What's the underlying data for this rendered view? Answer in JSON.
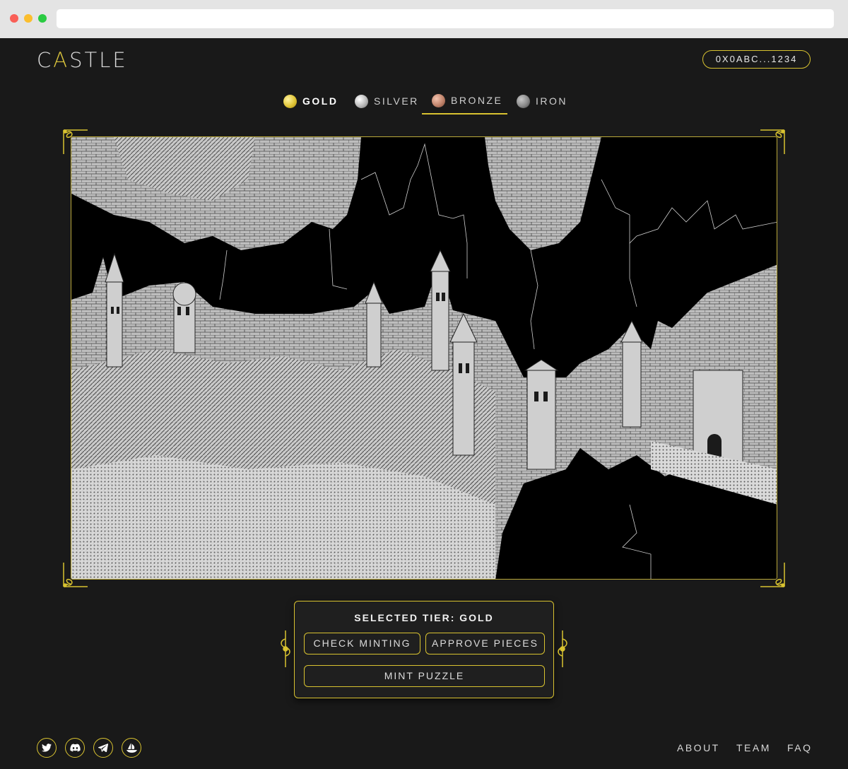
{
  "header": {
    "logo_prefix": "C",
    "logo_accent": "A",
    "logo_suffix": "STLE",
    "wallet_address": "0X0ABC...1234"
  },
  "tiers": [
    {
      "label": "GOLD",
      "color": "#e0c537"
    },
    {
      "label": "SILVER",
      "color": "#b9b9b9"
    },
    {
      "label": "BRONZE",
      "color": "#c0836b"
    },
    {
      "label": "IRON",
      "color": "#8a8a8a"
    }
  ],
  "panel": {
    "selected_tier_text": "SELECTED TIER: GOLD",
    "check_minting_label": "CHECK MINTING",
    "approve_pieces_label": "APPROVE PIECES",
    "mint_puzzle_label": "MINT PUZZLE"
  },
  "footer": {
    "social_icons": [
      "twitter-icon",
      "discord-icon",
      "telegram-icon",
      "opensea-icon"
    ],
    "links": [
      "ABOUT",
      "TEAM",
      "FAQ"
    ]
  },
  "colors": {
    "accent": "#d8c230",
    "background": "#191919"
  }
}
